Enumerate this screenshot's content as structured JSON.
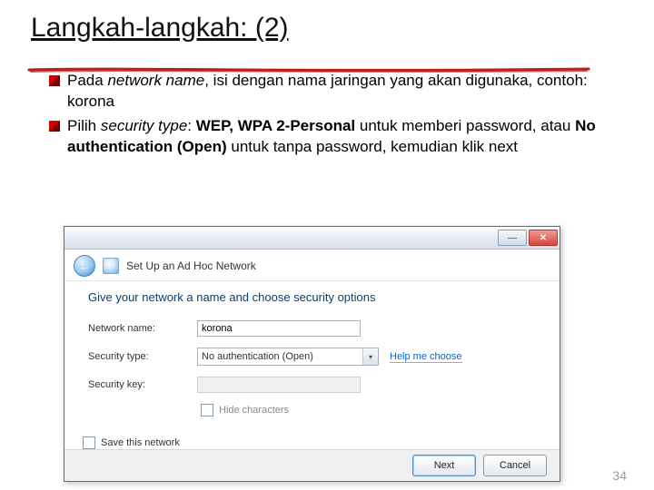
{
  "title": "Langkah-langkah: (2)",
  "bullets": [
    {
      "pre": "Pada ",
      "em": "network name",
      "post": ", isi dengan nama jaringan yang akan digunaka, contoh: korona"
    },
    {
      "pre": "Pilih ",
      "em": "security type",
      "post1": ": ",
      "b1": "WEP, WPA 2-Personal",
      "mid": " untuk memberi password, atau ",
      "b2": "No authentication (Open)",
      "post2": " untuk tanpa password, kemudian klik next"
    }
  ],
  "dialog": {
    "wizard_name": "Set Up an Ad Hoc Network",
    "heading": "Give your network a name and choose security options",
    "labels": {
      "network_name": "Network name:",
      "security_type": "Security type:",
      "security_key": "Security key:"
    },
    "fields": {
      "network_name_value": "korona",
      "security_type_value": "No authentication (Open)",
      "security_key_value": ""
    },
    "help_link": "Help me choose",
    "hide_chars": "Hide characters",
    "save_network": "Save this network",
    "buttons": {
      "next": "Next",
      "cancel": "Cancel"
    },
    "icons": {
      "back": "back-arrow-icon",
      "dropdown": "chevron-down-icon",
      "close": "close-icon",
      "minimize": "minimize-icon"
    }
  },
  "page_number": "34"
}
